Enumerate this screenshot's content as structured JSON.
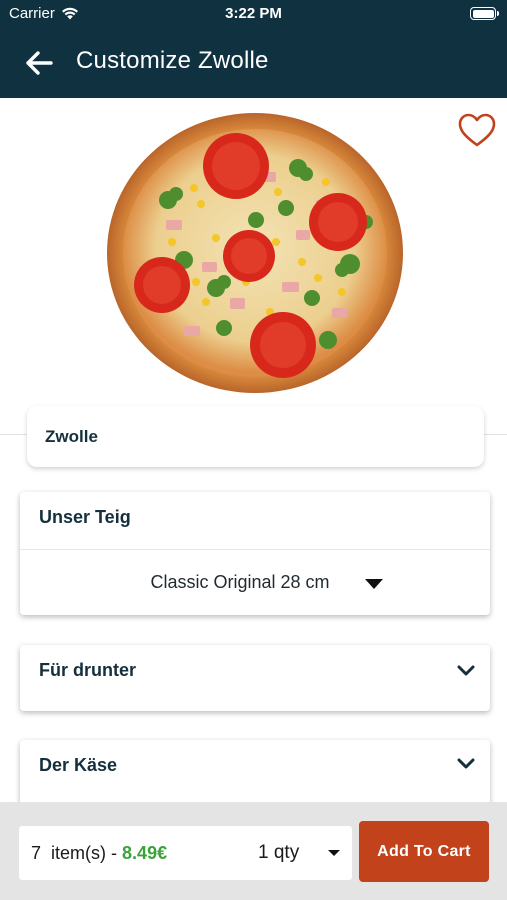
{
  "status_bar": {
    "carrier": "Carrier",
    "time": "3:22 PM",
    "icons": [
      "wifi-icon",
      "battery-icon"
    ]
  },
  "header": {
    "title": "Customize Zwolle",
    "back_icon": "arrow-left-icon"
  },
  "product": {
    "image": "pizza-photo",
    "favorite_icon": "heart-outline-icon",
    "name": "Zwolle"
  },
  "options": [
    {
      "heading": "Unser Teig",
      "selected": "Classic Original 28 cm",
      "expanded": true
    },
    {
      "heading": "Für drunter",
      "expanded": false
    },
    {
      "heading": "Der Käse",
      "expanded": false
    }
  ],
  "cart_bar": {
    "item_count": "7",
    "items_label": "item(s) -",
    "price": "8.49€",
    "qty_label": "1 qty",
    "add_button": "Add To Cart"
  },
  "colors": {
    "header_bg": "#0f3140",
    "accent_orange": "#c2421c",
    "price_green": "#3aa43a",
    "bottom_bar_bg": "#e4e4e4"
  }
}
